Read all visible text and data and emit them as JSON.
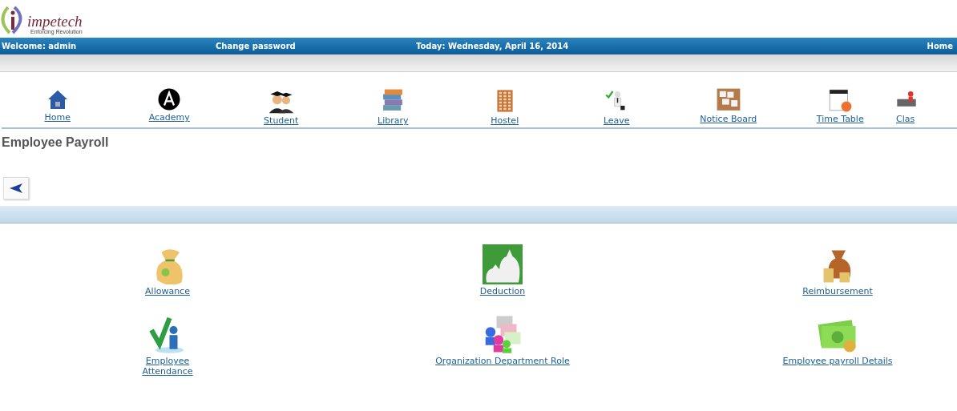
{
  "logo": {
    "name": "impetech",
    "tagline": "Enforcing Revolution"
  },
  "top_bar": {
    "welcome": "Welcome: admin",
    "change_password": "Change password",
    "today": "Today: Wednesday, April 16, 2014",
    "home": "Home"
  },
  "nav": [
    {
      "label": "Home"
    },
    {
      "label": "Academy"
    },
    {
      "label": "Student"
    },
    {
      "label": "Library"
    },
    {
      "label": "Hostel"
    },
    {
      "label": "Leave"
    },
    {
      "label": "Notice Board"
    },
    {
      "label": "Time Table"
    },
    {
      "label": "Clas"
    }
  ],
  "page_title": "Employee Payroll",
  "modules": [
    {
      "label": "Allowance"
    },
    {
      "label": "Deduction"
    },
    {
      "label": "Reimbursement"
    },
    {
      "label": "Employee Attendance"
    },
    {
      "label": "Organization Department Role"
    },
    {
      "label": "Employee payroll Details"
    }
  ]
}
